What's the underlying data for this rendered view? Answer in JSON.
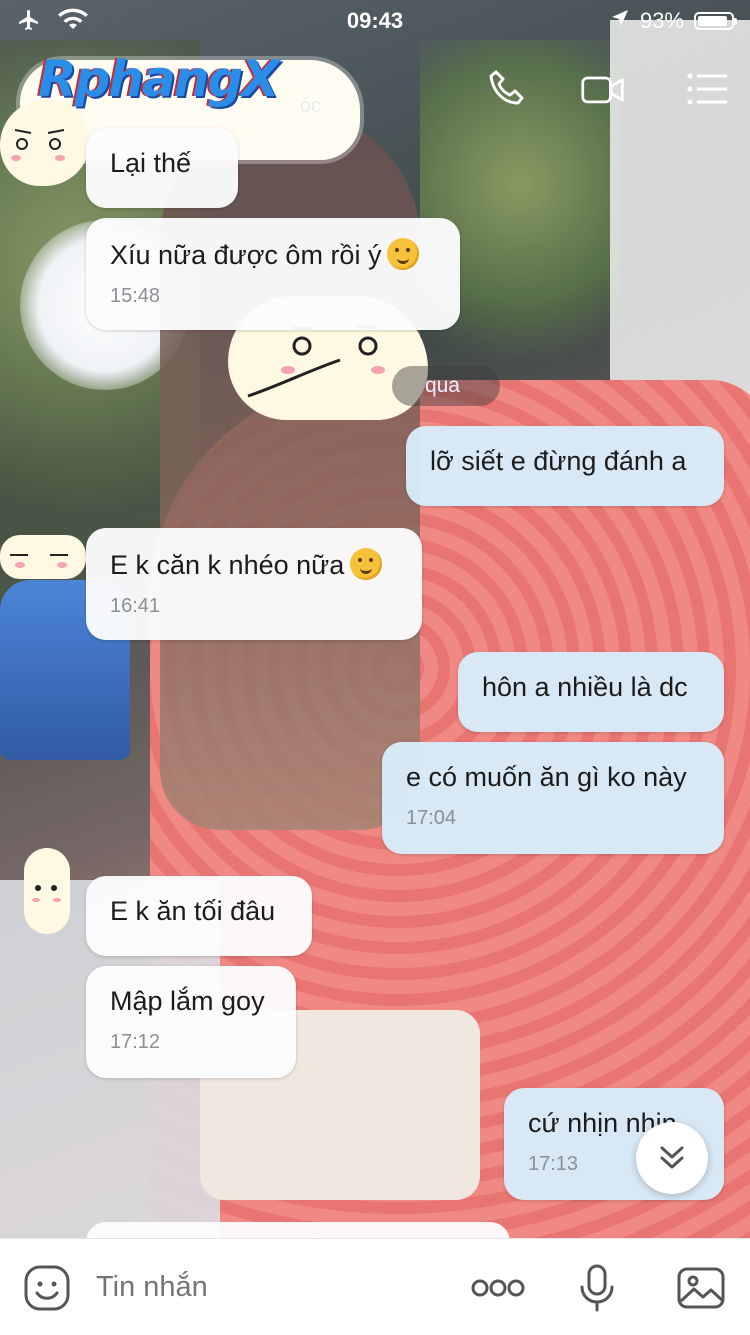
{
  "status_bar": {
    "time": "09:43",
    "battery_percent": "93%",
    "battery_level": 0.93
  },
  "header": {
    "logo_text": "RphangX",
    "chat_status": "óc",
    "icons": [
      "phone-icon",
      "video-call-icon",
      "menu-list-icon"
    ]
  },
  "date_separator": "qua",
  "messages": [
    {
      "side": "in",
      "text": "Lại thế",
      "time": ""
    },
    {
      "side": "in",
      "text": "Xíu nữa được ôm rồi ý",
      "emoji": "thinking-emoji",
      "time": "15:48"
    },
    {
      "side": "out",
      "text": "lỡ siết e đừng đánh a",
      "time": ""
    },
    {
      "side": "in",
      "text": "E k căn k nhéo nữa",
      "emoji": "thinking-emoji",
      "time": "16:41"
    },
    {
      "side": "out",
      "text": "hôn a nhiều là dc",
      "time": ""
    },
    {
      "side": "out",
      "text": "e có muốn ăn gì ko này",
      "time": "17:04"
    },
    {
      "side": "in",
      "text": "E k ăn tối đâu",
      "time": ""
    },
    {
      "side": "in",
      "text": "Mập lắm goy",
      "time": "17:12"
    },
    {
      "side": "out",
      "text": "cứ nhịn nhịn",
      "time": "17:13"
    }
  ],
  "input_bar": {
    "placeholder": "Tin nhắn",
    "icons": [
      "sticker-icon",
      "more-icon",
      "microphone-icon",
      "image-icon"
    ]
  },
  "colors": {
    "incoming_bubble": "#fcfcfd",
    "outgoing_bubble": "#d6ecfa",
    "timestamp": "#8a9096"
  }
}
